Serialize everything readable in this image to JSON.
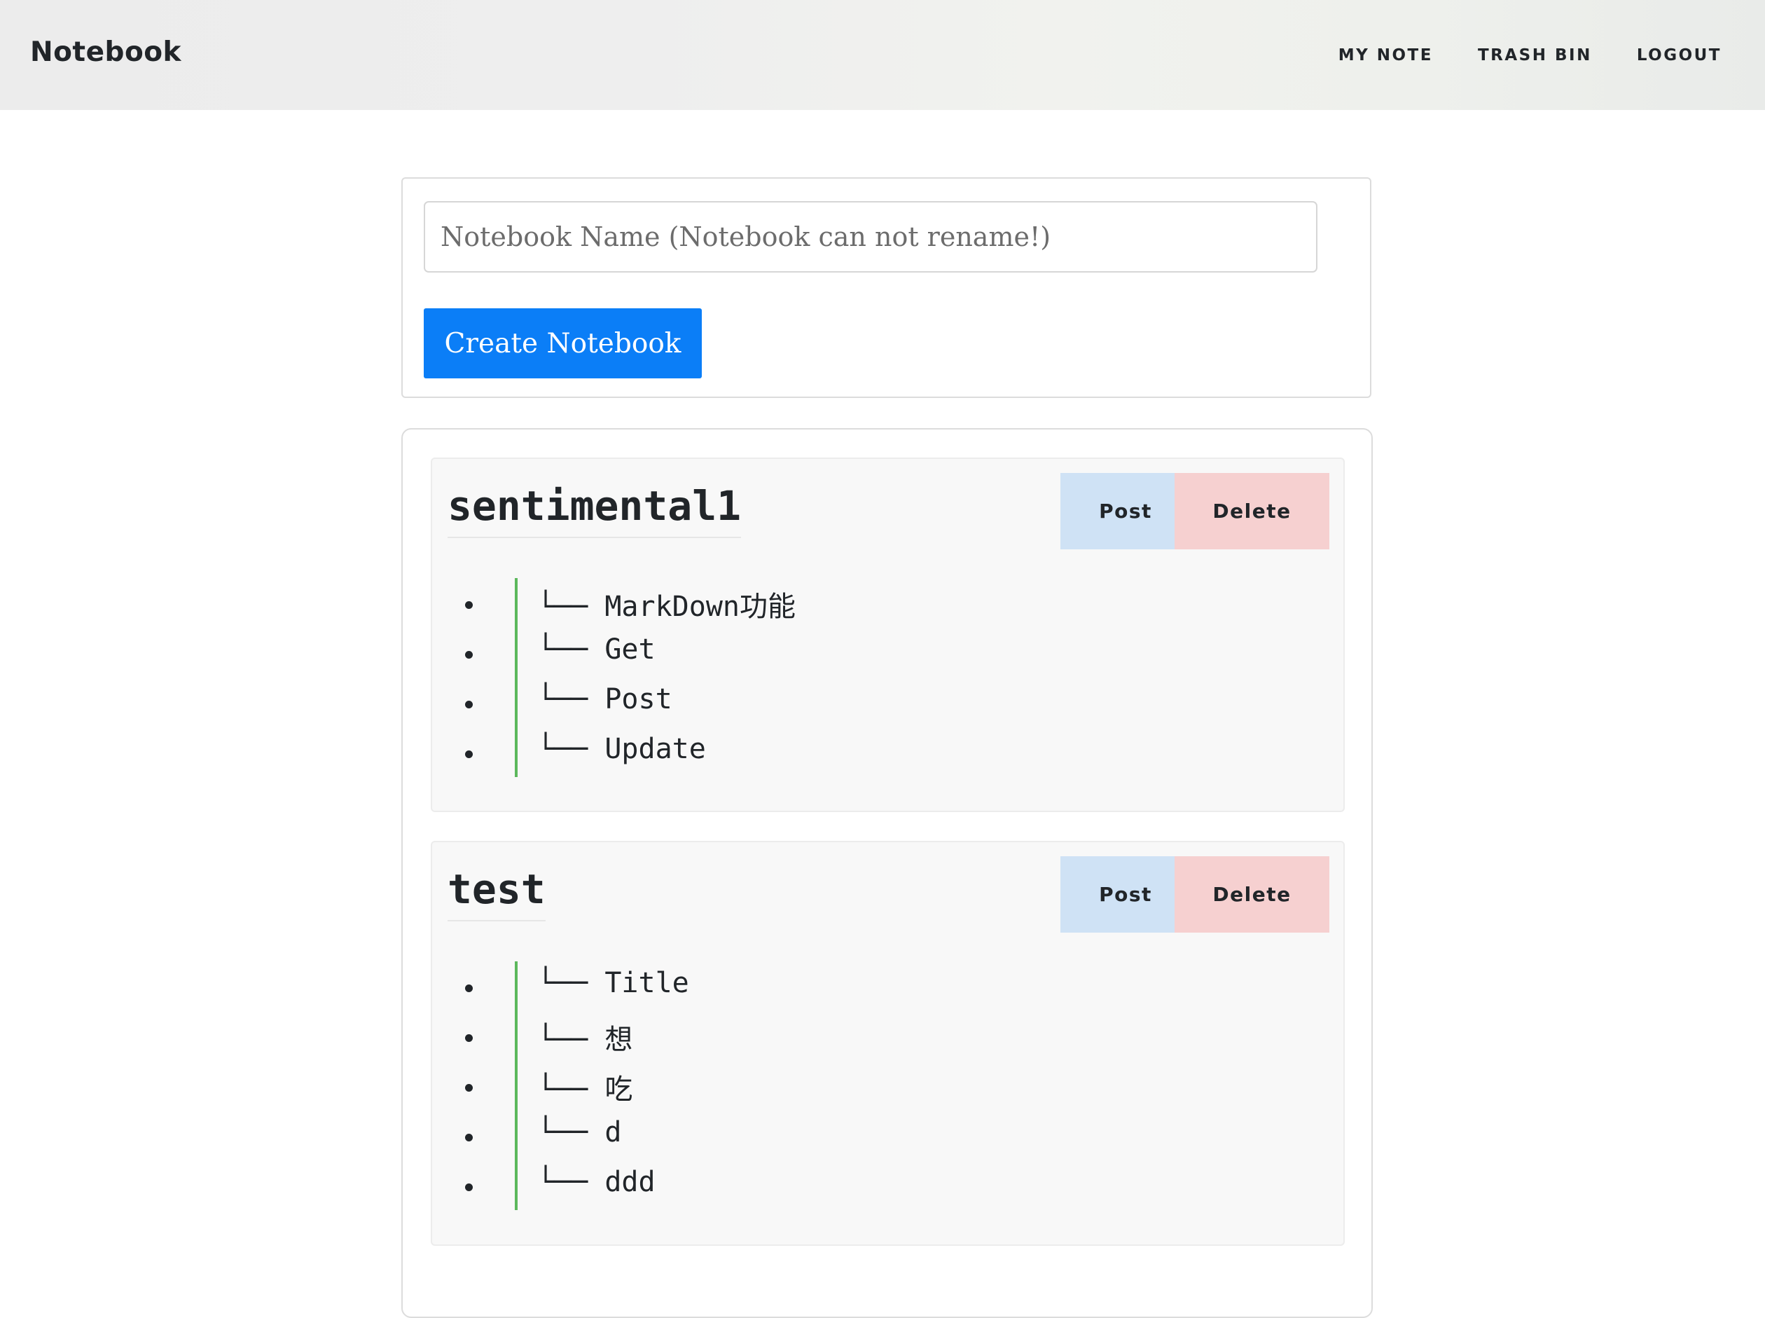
{
  "navbar": {
    "brand": "Notebook",
    "links": [
      "MY NOTE",
      "TRASH BIN",
      "LOGOUT"
    ]
  },
  "create": {
    "input_placeholder": "Notebook Name (Notebook can not rename!)",
    "input_value": "",
    "button_label": "Create Notebook"
  },
  "tree_prefix": "└── ",
  "notebooks": [
    {
      "name": "sentimental1",
      "post_label": "Post",
      "delete_label": "Delete",
      "notes": [
        "MarkDown功能",
        "Get",
        "Post",
        "Update"
      ]
    },
    {
      "name": "test",
      "post_label": "Post",
      "delete_label": "Delete",
      "notes": [
        "Title",
        "想",
        "吃",
        "d",
        "ddd"
      ]
    }
  ],
  "colors": {
    "primary": "#0b7ef7",
    "post_bg": "#cfe2f5",
    "delete_bg": "#f6d0d0",
    "tree_bar": "#5cb85c",
    "card_bg": "#f8f8f8"
  }
}
